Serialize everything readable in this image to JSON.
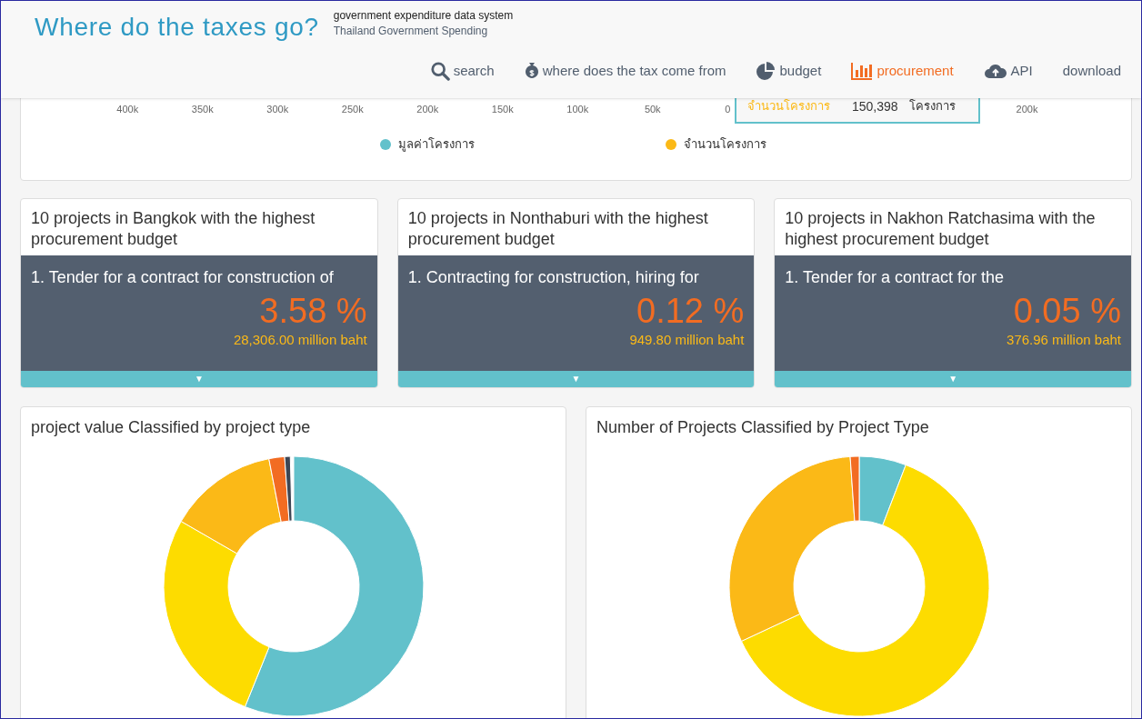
{
  "header": {
    "title": "Where do the taxes go?",
    "subtitle": "government expenditure data system",
    "subtitle_2": "Thailand Government Spending"
  },
  "nav": [
    {
      "label": "search",
      "selected": false
    },
    {
      "label": "where does the tax come from",
      "selected": false
    },
    {
      "label": "budget",
      "selected": false
    },
    {
      "label": "procurement",
      "selected": true
    },
    {
      "label": "API",
      "selected": false
    },
    {
      "label": "download",
      "selected": false
    }
  ],
  "top_chart": {
    "left_ticks": [
      "400k",
      "350k",
      "300k",
      "250k",
      "200k",
      "150k",
      "100k",
      "50k",
      "0"
    ],
    "right_ticks": [
      "200k"
    ],
    "tooltip": {
      "label": "จำนวนโครงการ",
      "value": "150,398",
      "unit": "โครงการ"
    },
    "legend": [
      {
        "label": "มูลค่าโครงการ",
        "color": "#62c1cb"
      },
      {
        "label": "จำนวนโครงการ",
        "color": "#fbb917"
      }
    ]
  },
  "province_cards": [
    {
      "title": "10 projects in Bangkok with the highest procurement budget",
      "item": "1. Tender for a contract for construction of",
      "percent": "3.58 %",
      "amount": "28,306.00 million baht",
      "toggle": "▼"
    },
    {
      "title": "10 projects in Nonthaburi with the highest procurement budget",
      "item": "1. Contracting for construction, hiring for",
      "percent": "0.12 %",
      "amount": "949.80 million baht",
      "toggle": "▼"
    },
    {
      "title": "10 projects in Nakhon Ratchasima with the highest procurement budget",
      "item": "1. Tender for a contract for the",
      "percent": "0.05 %",
      "amount": "376.96 million baht",
      "toggle": "▼"
    }
  ],
  "donut_cards": [
    {
      "title": "project value Classified by project type",
      "kind": "value"
    },
    {
      "title": "Number of Projects Classified by Project Type",
      "kind": "count"
    }
  ]
}
